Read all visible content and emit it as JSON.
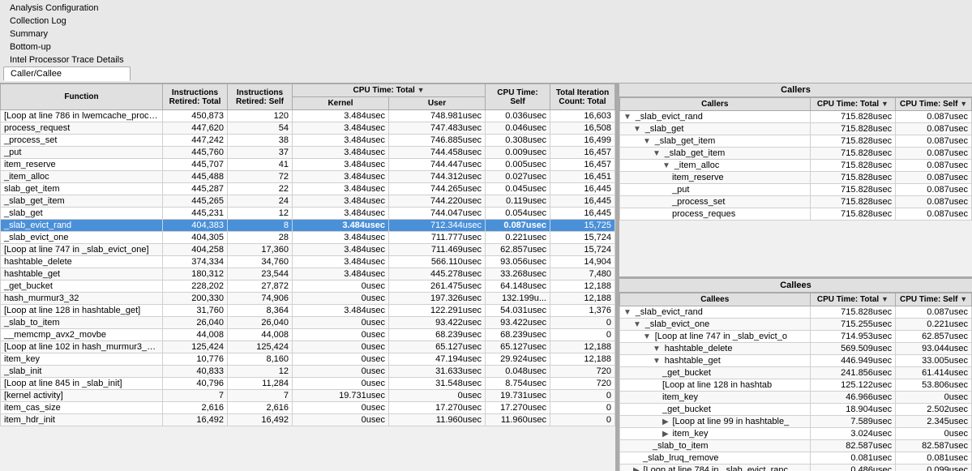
{
  "menu": {
    "items": [
      {
        "label": "Analysis Configuration",
        "active": false
      },
      {
        "label": "Collection Log",
        "active": false
      },
      {
        "label": "Summary",
        "active": false
      },
      {
        "label": "Bottom-up",
        "active": false
      },
      {
        "label": "Intel Processor Trace Details",
        "active": false
      },
      {
        "label": "Caller/Callee",
        "active": true
      }
    ]
  },
  "left_table": {
    "columns": [
      {
        "label": "Function"
      },
      {
        "label": "Instructions Retired: Total"
      },
      {
        "label": "Instructions Retired: Self"
      },
      {
        "label": "CPU Time: Total ▼"
      },
      {
        "label": "CPU Time: Total User"
      },
      {
        "label": "CPU Time: Self"
      },
      {
        "label": "Total Iteration Count: Total"
      }
    ],
    "col_groups": [
      {
        "label": "CPU Time: Total ▼",
        "colspan": 2
      },
      {
        "label": "CPU Time: Self",
        "colspan": 1
      }
    ],
    "rows": [
      {
        "func": "[Loop at line 786 in lwemcache_process_read]",
        "instr_total": "450,873",
        "instr_self": "120",
        "cpu_kernel": "3.484usec",
        "cpu_user": "748.981usec",
        "cpu_self": "0.036usec",
        "iter_count": "16,603",
        "selected": false,
        "indent": 0
      },
      {
        "func": "process_request",
        "instr_total": "447,620",
        "instr_self": "54",
        "cpu_kernel": "3.484usec",
        "cpu_user": "747.483usec",
        "cpu_self": "0.046usec",
        "iter_count": "16,508",
        "selected": false,
        "indent": 0
      },
      {
        "func": "_process_set",
        "instr_total": "447,242",
        "instr_self": "38",
        "cpu_kernel": "3.484usec",
        "cpu_user": "746.885usec",
        "cpu_self": "0.308usec",
        "iter_count": "16,499",
        "selected": false,
        "indent": 0
      },
      {
        "func": "_put",
        "instr_total": "445,760",
        "instr_self": "37",
        "cpu_kernel": "3.484usec",
        "cpu_user": "744.458usec",
        "cpu_self": "0.009usec",
        "iter_count": "16,457",
        "selected": false,
        "indent": 0
      },
      {
        "func": "item_reserve",
        "instr_total": "445,707",
        "instr_self": "41",
        "cpu_kernel": "3.484usec",
        "cpu_user": "744.447usec",
        "cpu_self": "0.005usec",
        "iter_count": "16,457",
        "selected": false,
        "indent": 0
      },
      {
        "func": "_item_alloc",
        "instr_total": "445,488",
        "instr_self": "72",
        "cpu_kernel": "3.484usec",
        "cpu_user": "744.312usec",
        "cpu_self": "0.027usec",
        "iter_count": "16,451",
        "selected": false,
        "indent": 0
      },
      {
        "func": "slab_get_item",
        "instr_total": "445,287",
        "instr_self": "22",
        "cpu_kernel": "3.484usec",
        "cpu_user": "744.265usec",
        "cpu_self": "0.045usec",
        "iter_count": "16,445",
        "selected": false,
        "indent": 0
      },
      {
        "func": "_slab_get_item",
        "instr_total": "445,265",
        "instr_self": "24",
        "cpu_kernel": "3.484usec",
        "cpu_user": "744.220usec",
        "cpu_self": "0.119usec",
        "iter_count": "16,445",
        "selected": false,
        "indent": 0
      },
      {
        "func": "_slab_get",
        "instr_total": "445,231",
        "instr_self": "12",
        "cpu_kernel": "3.484usec",
        "cpu_user": "744.047usec",
        "cpu_self": "0.054usec",
        "iter_count": "16,445",
        "selected": false,
        "indent": 0
      },
      {
        "func": "_slab_evict_rand",
        "instr_total": "404,383",
        "instr_self": "8",
        "cpu_kernel": "3.484usec",
        "cpu_user": "712.344usec",
        "cpu_self": "0.087usec",
        "iter_count": "15,725",
        "selected": true,
        "indent": 0
      },
      {
        "func": "_slab_evict_one",
        "instr_total": "404,305",
        "instr_self": "28",
        "cpu_kernel": "3.484usec",
        "cpu_user": "711.777usec",
        "cpu_self": "0.221usec",
        "iter_count": "15,724",
        "selected": false,
        "indent": 0
      },
      {
        "func": "[Loop at line 747 in _slab_evict_one]",
        "instr_total": "404,258",
        "instr_self": "17,360",
        "cpu_kernel": "3.484usec",
        "cpu_user": "711.469usec",
        "cpu_self": "62.857usec",
        "iter_count": "15,724",
        "selected": false,
        "indent": 0
      },
      {
        "func": "hashtable_delete",
        "instr_total": "374,334",
        "instr_self": "34,760",
        "cpu_kernel": "3.484usec",
        "cpu_user": "566.110usec",
        "cpu_self": "93.056usec",
        "iter_count": "14,904",
        "selected": false,
        "indent": 0
      },
      {
        "func": "hashtable_get",
        "instr_total": "180,312",
        "instr_self": "23,544",
        "cpu_kernel": "3.484usec",
        "cpu_user": "445.278usec",
        "cpu_self": "33.268usec",
        "iter_count": "7,480",
        "selected": false,
        "indent": 0
      },
      {
        "func": "_get_bucket",
        "instr_total": "228,202",
        "instr_self": "27,872",
        "cpu_kernel": "0usec",
        "cpu_user": "261.475usec",
        "cpu_self": "64.148usec",
        "iter_count": "12,188",
        "selected": false,
        "indent": 0
      },
      {
        "func": "hash_murmur3_32",
        "instr_total": "200,330",
        "instr_self": "74,906",
        "cpu_kernel": "0usec",
        "cpu_user": "197.326usec",
        "cpu_self": "132.199u...",
        "iter_count": "12,188",
        "selected": false,
        "indent": 0
      },
      {
        "func": "[Loop at line 128 in hashtable_get]",
        "instr_total": "31,760",
        "instr_self": "8,364",
        "cpu_kernel": "3.484usec",
        "cpu_user": "122.291usec",
        "cpu_self": "54.031usec",
        "iter_count": "1,376",
        "selected": false,
        "indent": 0
      },
      {
        "func": "_slab_to_item",
        "instr_total": "26,040",
        "instr_self": "26,040",
        "cpu_kernel": "0usec",
        "cpu_user": "93.422usec",
        "cpu_self": "93.422usec",
        "iter_count": "0",
        "selected": false,
        "indent": 0
      },
      {
        "func": "__memcmp_avx2_movbe",
        "instr_total": "44,008",
        "instr_self": "44,008",
        "cpu_kernel": "0usec",
        "cpu_user": "68.239usec",
        "cpu_self": "68.239usec",
        "iter_count": "0",
        "selected": false,
        "indent": 0
      },
      {
        "func": "[Loop at line 102 in hash_murmur3_32]",
        "instr_total": "125,424",
        "instr_self": "125,424",
        "cpu_kernel": "0usec",
        "cpu_user": "65.127usec",
        "cpu_self": "65.127usec",
        "iter_count": "12,188",
        "selected": false,
        "indent": 0
      },
      {
        "func": "item_key",
        "instr_total": "10,776",
        "instr_self": "8,160",
        "cpu_kernel": "0usec",
        "cpu_user": "47.194usec",
        "cpu_self": "29.924usec",
        "iter_count": "12,188",
        "selected": false,
        "indent": 0
      },
      {
        "func": "_slab_init",
        "instr_total": "40,833",
        "instr_self": "12",
        "cpu_kernel": "0usec",
        "cpu_user": "31.633usec",
        "cpu_self": "0.048usec",
        "iter_count": "720",
        "selected": false,
        "indent": 0
      },
      {
        "func": "[Loop at line 845 in _slab_init]",
        "instr_total": "40,796",
        "instr_self": "11,284",
        "cpu_kernel": "0usec",
        "cpu_user": "31.548usec",
        "cpu_self": "8.754usec",
        "iter_count": "720",
        "selected": false,
        "indent": 0
      },
      {
        "func": "[kernel activity]",
        "instr_total": "7",
        "instr_self": "7",
        "cpu_kernel": "19.731usec",
        "cpu_user": "0usec",
        "cpu_self": "19.731usec",
        "iter_count": "0",
        "selected": false,
        "indent": 0
      },
      {
        "func": "item_cas_size",
        "instr_total": "2,616",
        "instr_self": "2,616",
        "cpu_kernel": "0usec",
        "cpu_user": "17.270usec",
        "cpu_self": "17.270usec",
        "iter_count": "0",
        "selected": false,
        "indent": 0
      },
      {
        "func": "item_hdr_init",
        "instr_total": "16,492",
        "instr_self": "16,492",
        "cpu_kernel": "0usec",
        "cpu_user": "11.960usec",
        "cpu_self": "11.960usec",
        "iter_count": "0",
        "selected": false,
        "indent": 0
      }
    ]
  },
  "callers": {
    "title": "Callers",
    "col_total_label": "CPU Time: Total ▼",
    "col_self_label": "CPU Time: Self",
    "rows": [
      {
        "func": "_slab_evict_rand",
        "cpu_total": "715.828usec",
        "cpu_self": "0.087usec",
        "indent": 0,
        "arrow": "▼"
      },
      {
        "func": "_slab_get",
        "cpu_total": "715.828usec",
        "cpu_self": "0.087usec",
        "indent": 1,
        "arrow": "▼"
      },
      {
        "func": "_slab_get_item",
        "cpu_total": "715.828usec",
        "cpu_self": "0.087usec",
        "indent": 2,
        "arrow": "▼"
      },
      {
        "func": "_slab_get_item",
        "cpu_total": "715.828usec",
        "cpu_self": "0.087usec",
        "indent": 3,
        "arrow": "▼"
      },
      {
        "func": "_item_alloc",
        "cpu_total": "715.828usec",
        "cpu_self": "0.087usec",
        "indent": 4,
        "arrow": "▼"
      },
      {
        "func": "item_reserve",
        "cpu_total": "715.828usec",
        "cpu_self": "0.087usec",
        "indent": 5,
        "arrow": ""
      },
      {
        "func": "_put",
        "cpu_total": "715.828usec",
        "cpu_self": "0.087usec",
        "indent": 5,
        "arrow": ""
      },
      {
        "func": "_process_set",
        "cpu_total": "715.828usec",
        "cpu_self": "0.087usec",
        "indent": 5,
        "arrow": ""
      },
      {
        "func": "process_reques",
        "cpu_total": "715.828usec",
        "cpu_self": "0.087usec",
        "indent": 5,
        "arrow": ""
      }
    ]
  },
  "callees": {
    "title": "Callees",
    "col_total_label": "CPU Time: Total ▼",
    "col_self_label": "CPU Time: Self",
    "rows": [
      {
        "func": "_slab_evict_rand",
        "cpu_total": "715.828usec",
        "cpu_self": "0.087usec",
        "indent": 0,
        "arrow": "▼"
      },
      {
        "func": "_slab_evict_one",
        "cpu_total": "715.255usec",
        "cpu_self": "0.221usec",
        "indent": 1,
        "arrow": "▼"
      },
      {
        "func": "[Loop at line 747 in _slab_evict_o",
        "cpu_total": "714.953usec",
        "cpu_self": "62.857usec",
        "indent": 2,
        "arrow": "▼"
      },
      {
        "func": "hashtable_delete",
        "cpu_total": "569.509usec",
        "cpu_self": "93.044usec",
        "indent": 3,
        "arrow": "▼"
      },
      {
        "func": "hashtable_get",
        "cpu_total": "446.949usec",
        "cpu_self": "33.005usec",
        "indent": 3,
        "arrow": "▼"
      },
      {
        "func": "_get_bucket",
        "cpu_total": "241.856usec",
        "cpu_self": "61.414usec",
        "indent": 4,
        "arrow": ""
      },
      {
        "func": "[Loop at line 128 in hashtab",
        "cpu_total": "125.122usec",
        "cpu_self": "53.806usec",
        "indent": 4,
        "arrow": ""
      },
      {
        "func": "item_key",
        "cpu_total": "46.966usec",
        "cpu_self": "0usec",
        "indent": 4,
        "arrow": ""
      },
      {
        "func": "_get_bucket",
        "cpu_total": "18.904usec",
        "cpu_self": "2.502usec",
        "indent": 4,
        "arrow": ""
      },
      {
        "func": "[Loop at line 99 in hashtable_",
        "cpu_total": "7.589usec",
        "cpu_self": "2.345usec",
        "indent": 4,
        "arrow": "▶"
      },
      {
        "func": "item_key",
        "cpu_total": "3.024usec",
        "cpu_self": "0usec",
        "indent": 4,
        "arrow": "▶"
      },
      {
        "func": "_slab_to_item",
        "cpu_total": "82.587usec",
        "cpu_self": "82.587usec",
        "indent": 3,
        "arrow": ""
      },
      {
        "func": "_slab_lruq_remove",
        "cpu_total": "0.081usec",
        "cpu_self": "0.081usec",
        "indent": 2,
        "arrow": ""
      },
      {
        "func": "[Loop at line 784 in _slab_evict_ranc",
        "cpu_total": "0.486usec",
        "cpu_self": "0.099usec",
        "indent": 1,
        "arrow": "▶"
      }
    ]
  }
}
